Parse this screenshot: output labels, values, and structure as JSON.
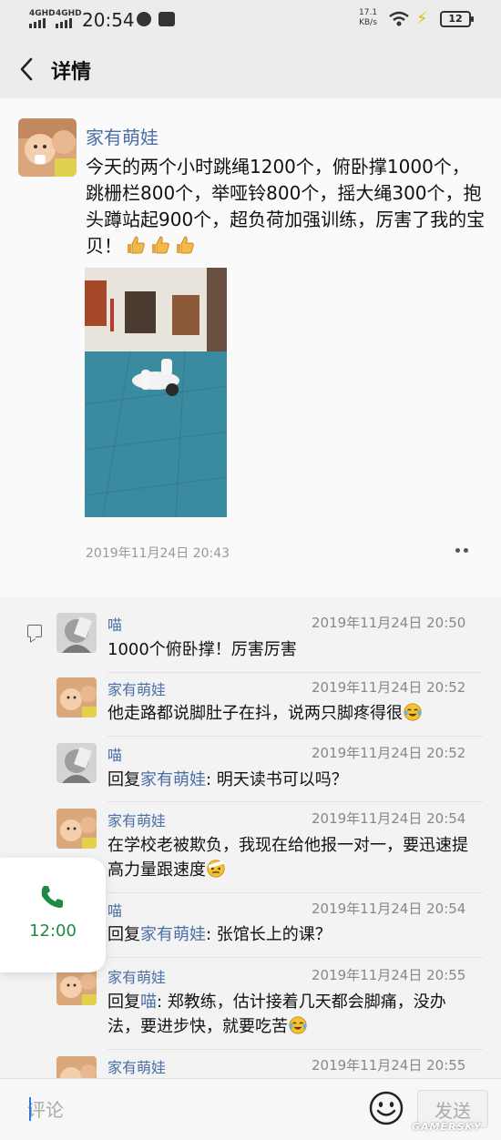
{
  "status_bar": {
    "signal1": "4GHD",
    "signal2": "4GHD",
    "time": "20:54",
    "speed_value": "17.1",
    "speed_unit": "KB/s",
    "battery": "12",
    "icons": [
      "signal-icon",
      "wechat-icon",
      "app-icon",
      "wifi-icon",
      "charging-icon",
      "battery-icon"
    ]
  },
  "nav": {
    "title": "详情",
    "back_icon": "chevron-left-icon"
  },
  "post": {
    "author": "家有萌娃",
    "text": "今天的两个小时跳绳1200个，俯卧撑1000个，跳栅栏800个，举哑铃800个，摇大绳300个，抱头蹲站起900个，超负荷加强训练，厉害了我的宝贝！",
    "emoji": "thumbs-up-icon",
    "timestamp": "2019年11月24日 20:43"
  },
  "comments": [
    {
      "name": "喵",
      "time": "2019年11月24日 20:50",
      "reply_prefix": "",
      "reply_target": "",
      "text": "1000个俯卧撑！厉害厉害",
      "emoji": ""
    },
    {
      "name": "家有萌娃",
      "time": "2019年11月24日 20:52",
      "reply_prefix": "",
      "reply_target": "",
      "text": "他走路都说脚肚子在抖，说两只脚疼得很",
      "emoji": "laughing-tears-icon"
    },
    {
      "name": "喵",
      "time": "2019年11月24日 20:52",
      "reply_prefix": "回复",
      "reply_target": "家有萌娃",
      "text": ": 明天读书可以吗？",
      "emoji": ""
    },
    {
      "name": "家有萌娃",
      "time": "2019年11月24日 20:54",
      "reply_prefix": "",
      "reply_target": "",
      "text": "在学校老被欺负，我现在给他报一对一，要迅速提高力量跟速度",
      "emoji": "bandage-face-icon"
    },
    {
      "name": "喵",
      "time": "2019年11月24日 20:54",
      "reply_prefix": "回复",
      "reply_target": "家有萌娃",
      "text": ": 张馆长上的课？",
      "emoji": ""
    },
    {
      "name": "家有萌娃",
      "time": "2019年11月24日 20:55",
      "reply_prefix": "回复",
      "reply_target": "喵",
      "text": ": 郑教练，估计接着几天都会脚痛，没办法，要进步快，就要吃苦",
      "emoji": "laughing-tears-icon"
    },
    {
      "name": "家有萌娃",
      "time": "2019年11月24日 20:55",
      "reply_prefix": "",
      "reply_target": "",
      "text": "",
      "emoji": ""
    }
  ],
  "call_widget": {
    "time": "12:00",
    "icon": "phone-icon"
  },
  "input_bar": {
    "placeholder": "评论",
    "emoji_icon": "smiley-icon",
    "send_label": "发送"
  },
  "watermark": "GAMERSKY",
  "colors": {
    "link": "#4a6fa5",
    "call_green": "#1e8a45",
    "background": "#f0f0f0"
  }
}
